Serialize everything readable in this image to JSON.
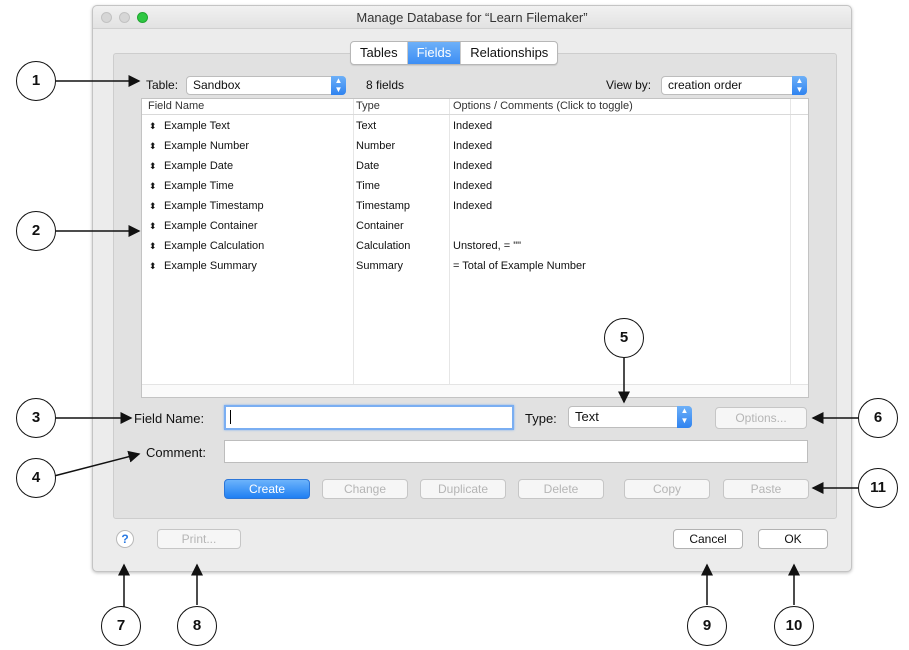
{
  "window": {
    "title": "Manage Database for “Learn Filemaker”"
  },
  "tabs": [
    {
      "label": "Tables",
      "active": false
    },
    {
      "label": "Fields",
      "active": true
    },
    {
      "label": "Relationships",
      "active": false
    }
  ],
  "table_select": {
    "label": "Table:",
    "value": "Sandbox"
  },
  "field_count": "8 fields",
  "view_by": {
    "label": "View by:",
    "value": "creation order"
  },
  "list": {
    "headers": {
      "name": "Field Name",
      "type": "Type",
      "options": "Options / Comments   (Click to toggle)"
    },
    "rows": [
      {
        "name": "Example Text",
        "type": "Text",
        "options": "Indexed"
      },
      {
        "name": "Example Number",
        "type": "Number",
        "options": "Indexed"
      },
      {
        "name": "Example Date",
        "type": "Date",
        "options": "Indexed"
      },
      {
        "name": "Example Time",
        "type": "Time",
        "options": "Indexed"
      },
      {
        "name": "Example Timestamp",
        "type": "Timestamp",
        "options": "Indexed"
      },
      {
        "name": "Example Container",
        "type": "Container",
        "options": ""
      },
      {
        "name": "Example Calculation",
        "type": "Calculation",
        "options": "Unstored, = \"\""
      },
      {
        "name": "Example Summary",
        "type": "Summary",
        "options": "= Total of Example Number"
      }
    ]
  },
  "field_name": {
    "label": "Field Name:",
    "value": ""
  },
  "type_select": {
    "label": "Type:",
    "value": "Text"
  },
  "comment": {
    "label": "Comment:",
    "value": ""
  },
  "buttons": {
    "options": "Options...",
    "create": "Create",
    "change": "Change",
    "duplicate": "Duplicate",
    "delete": "Delete",
    "copy": "Copy",
    "paste": "Paste",
    "print": "Print...",
    "cancel": "Cancel",
    "ok": "OK",
    "help": "?"
  },
  "callouts": [
    "1",
    "2",
    "3",
    "4",
    "5",
    "6",
    "7",
    "8",
    "9",
    "10",
    "11"
  ],
  "colors": {
    "accent": "#3d8ef4",
    "window_bg": "#ececec"
  }
}
